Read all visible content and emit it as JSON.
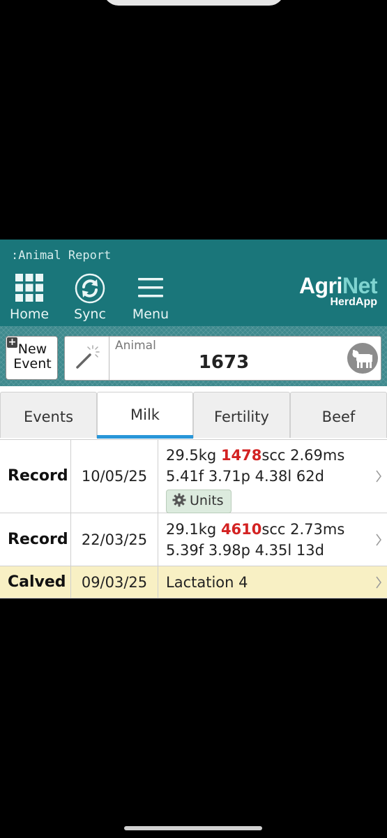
{
  "app": {
    "title": ":Animal Report",
    "brand": {
      "agri": "Agri",
      "net": "Net",
      "sub": "HerdApp"
    }
  },
  "nav": [
    {
      "label": "Home",
      "icon": "grid-icon"
    },
    {
      "label": "Sync",
      "icon": "sync-icon"
    },
    {
      "label": "Menu",
      "icon": "hamburger-icon"
    }
  ],
  "search": {
    "new_event_plus": "+",
    "new_event_line1": "New",
    "new_event_line2": "Event",
    "animal_label": "Animal",
    "animal_value": "1673"
  },
  "tabs": [
    {
      "label": "Events",
      "active": false
    },
    {
      "label": "Milk",
      "active": true
    },
    {
      "label": "Fertility",
      "active": false
    },
    {
      "label": "Beef",
      "active": false
    }
  ],
  "rows": [
    {
      "type": "Record",
      "date": "10/05/25",
      "kg": "29.5kg ",
      "scc": "1478",
      "scc_suffix": "scc 2.69ms",
      "line2": "5.41f 3.71p 4.38l 62d",
      "units_label": "Units"
    },
    {
      "type": "Record",
      "date": "22/03/25",
      "kg": "29.1kg ",
      "scc": "4610",
      "scc_suffix": "scc 2.73ms",
      "line2": "5.39f 3.98p 4.35l 13d"
    },
    {
      "type": "Calved",
      "date": "09/03/25",
      "detail": "Lactation 4"
    }
  ],
  "colors": {
    "header_bg": "#1a767a",
    "scc_highlight": "#d32222",
    "active_tab_underline": "#2996d8",
    "calved_row_bg": "#f8f0c4"
  }
}
